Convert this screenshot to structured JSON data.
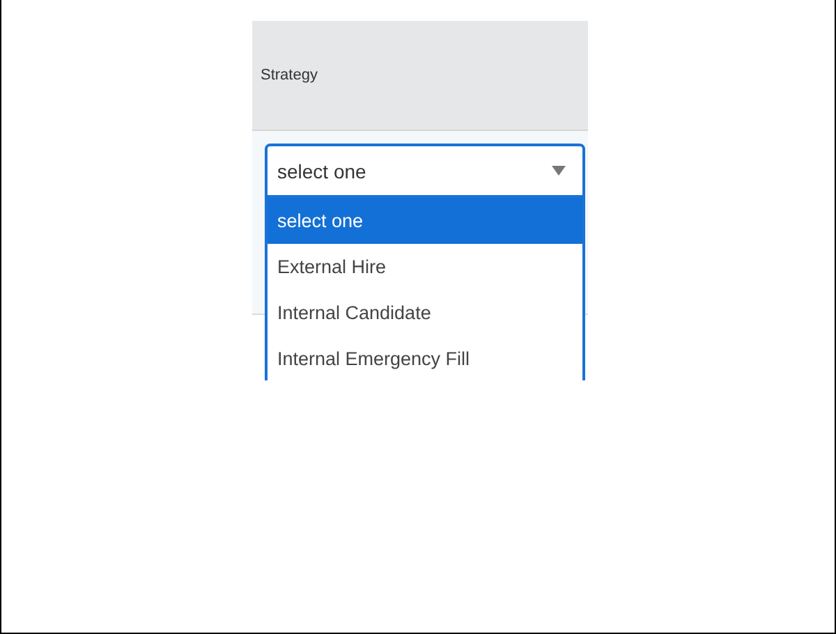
{
  "column_header": "Strategy",
  "select": {
    "value": "select one",
    "expanded": true
  },
  "options": [
    {
      "label": "select one",
      "selected": true
    },
    {
      "label": "External Hire",
      "selected": false
    },
    {
      "label": "Internal Candidate",
      "selected": false
    },
    {
      "label": "Internal Emergency Fill",
      "selected": false
    }
  ]
}
